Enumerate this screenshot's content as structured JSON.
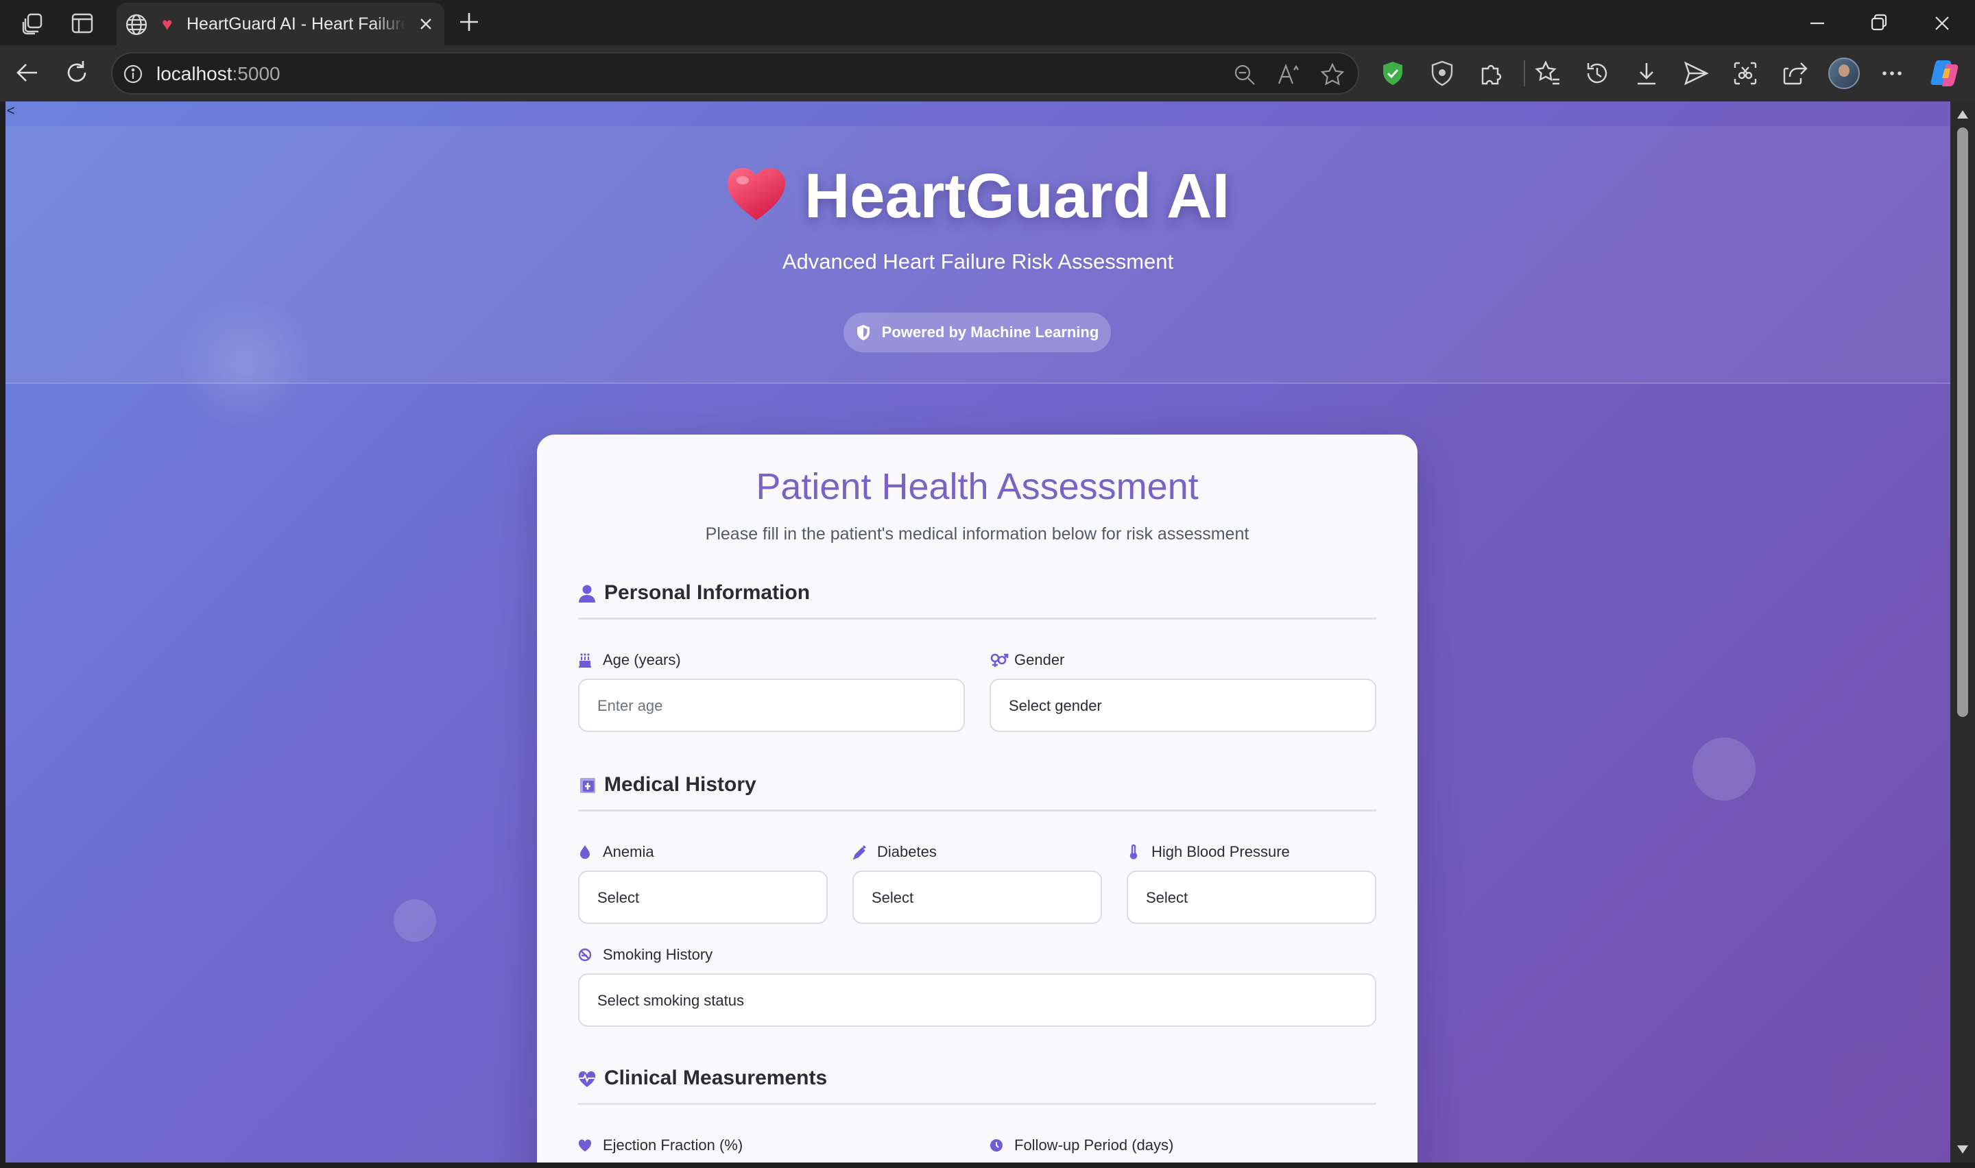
{
  "browser": {
    "tab_title": "HeartGuard AI - Heart Failure Risk Assessment",
    "url_host": "localhost",
    "url_port": ":5000"
  },
  "hero": {
    "back_text": "<",
    "title": "HeartGuard AI",
    "subtitle": "Advanced Heart Failure Risk Assessment",
    "badge": "Powered by Machine Learning",
    "heart_icon": "heart-emoji"
  },
  "form": {
    "title": "Patient Health Assessment",
    "subtitle": "Please fill in the patient's medical information below for risk assessment",
    "personal": {
      "heading": "Personal Information",
      "age_label": "Age (years)",
      "age_placeholder": "Enter age",
      "gender_label": "Gender",
      "gender_value": "Select gender"
    },
    "medical": {
      "heading": "Medical History",
      "anemia_label": "Anemia",
      "anemia_value": "Select",
      "diabetes_label": "Diabetes",
      "diabetes_value": "Select",
      "bp_label": "High Blood Pressure",
      "bp_value": "Select",
      "smoking_label": "Smoking History",
      "smoking_value": "Select smoking status"
    },
    "clinical": {
      "heading": "Clinical Measurements",
      "ef_label": "Ejection Fraction (%)",
      "followup_label": "Follow-up Period (days)"
    }
  },
  "colors": {
    "accent": "#6e5dd6",
    "title": "#7a63c7",
    "bg_start": "#6c83dc",
    "bg_end": "#734fad",
    "heart": "#e8445f"
  }
}
